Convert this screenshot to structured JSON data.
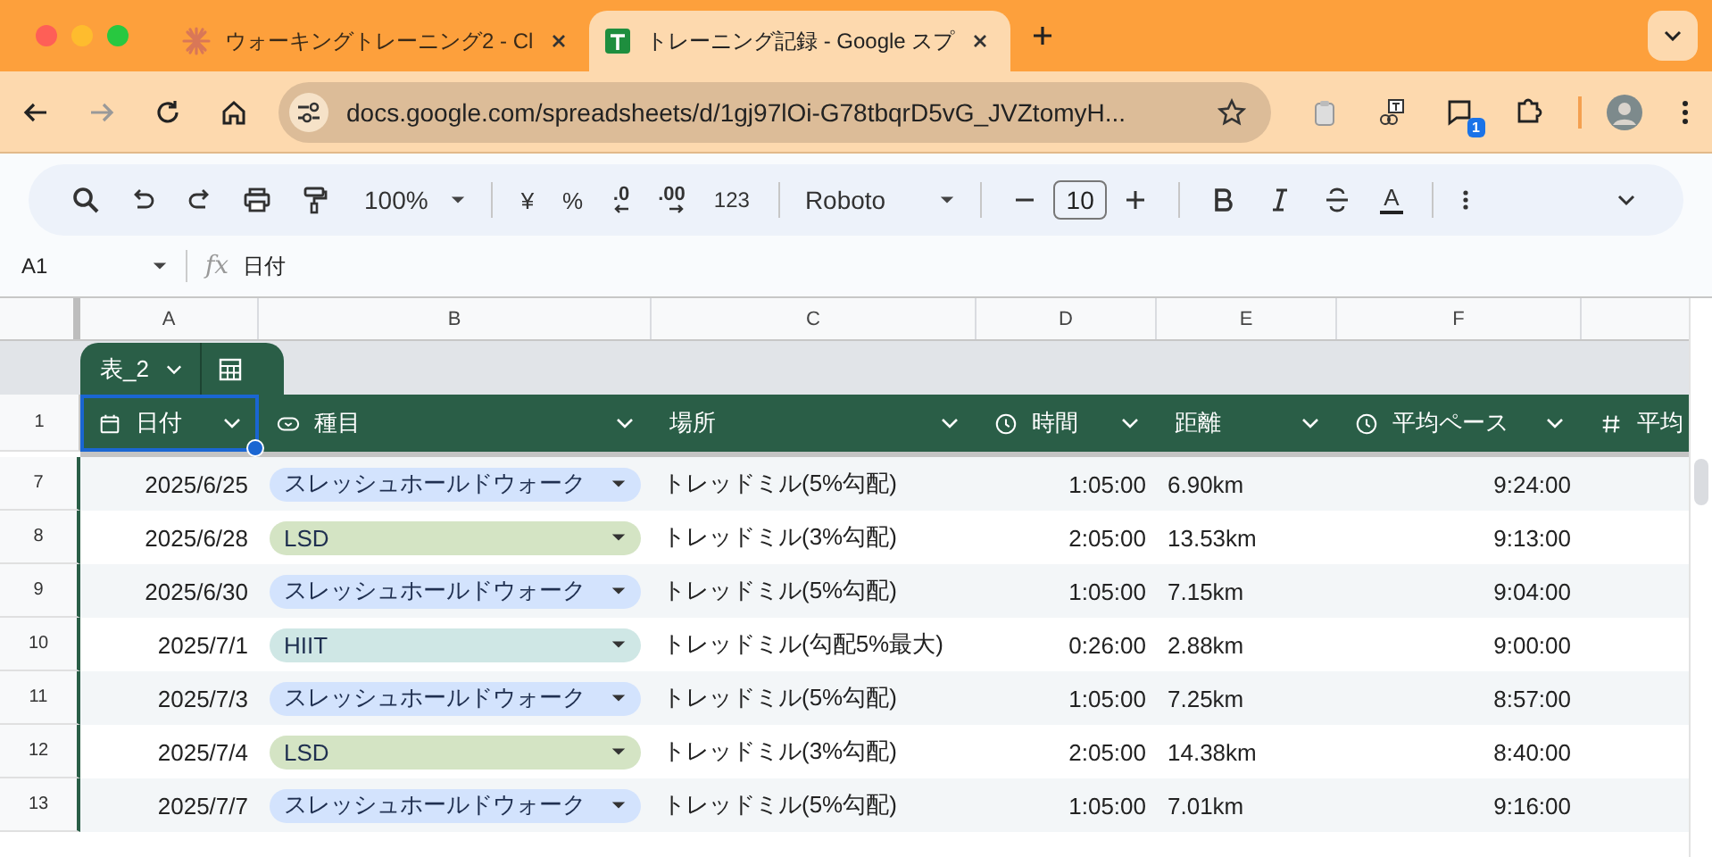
{
  "browser": {
    "tabs": [
      {
        "title": "ウォーキングトレーニング2 - Cl",
        "kind": "claude",
        "selected": false
      },
      {
        "title": "トレーニング記録 - Google スプ",
        "kind": "sheets",
        "selected": true
      }
    ],
    "address": "docs.google.com/spreadsheets/d/1gj97lOi-G78tbqrD5vG_JVZtomyH...",
    "extension_badge": "1"
  },
  "toolbar": {
    "zoom": "100%",
    "currency": "¥",
    "percent": "%",
    "decrease_decimal": ".0",
    "increase_decimal": ".00",
    "number_format": "123",
    "font": "Roboto",
    "font_size": "10",
    "text_color": "A"
  },
  "formula_bar": {
    "cell": "A1",
    "fx": "fx",
    "value": "日付"
  },
  "sheet": {
    "column_letters": [
      "A",
      "B",
      "C",
      "D",
      "E",
      "F"
    ],
    "table_name": "表_2",
    "header_row": "1",
    "columns": [
      {
        "label": "日付",
        "kind": "date",
        "selected": true
      },
      {
        "label": "種目",
        "kind": "chip",
        "selected": false
      },
      {
        "label": "場所",
        "kind": "text",
        "selected": false
      },
      {
        "label": "時間",
        "kind": "time",
        "selected": false
      },
      {
        "label": "距離",
        "kind": "text",
        "selected": false
      },
      {
        "label": "平均ペース",
        "kind": "time",
        "selected": false
      },
      {
        "label": "平均",
        "kind": "number",
        "selected": false
      }
    ],
    "rows": [
      {
        "num": "7",
        "date": "2025/6/25",
        "type": {
          "label": "スレッシュホールドウォーク",
          "color": "#d3e3fd"
        },
        "place": "トレッドミル(5%勾配)",
        "time": "1:05:00",
        "distance": "6.90km",
        "pace": "9:24:00"
      },
      {
        "num": "8",
        "date": "2025/6/28",
        "type": {
          "label": "LSD",
          "color": "#d4e4c4"
        },
        "place": "トレッドミル(3%勾配)",
        "time": "2:05:00",
        "distance": "13.53km",
        "pace": "9:13:00"
      },
      {
        "num": "9",
        "date": "2025/6/30",
        "type": {
          "label": "スレッシュホールドウォーク",
          "color": "#d3e3fd"
        },
        "place": "トレッドミル(5%勾配)",
        "time": "1:05:00",
        "distance": "7.15km",
        "pace": "9:04:00"
      },
      {
        "num": "10",
        "date": "2025/7/1",
        "type": {
          "label": "HIIT",
          "color": "#cfe7e5"
        },
        "place": "トレッドミル(勾配5%最大)",
        "time": "0:26:00",
        "distance": "2.88km",
        "pace": "9:00:00"
      },
      {
        "num": "11",
        "date": "2025/7/3",
        "type": {
          "label": "スレッシュホールドウォーク",
          "color": "#d3e3fd"
        },
        "place": "トレッドミル(5%勾配)",
        "time": "1:05:00",
        "distance": "7.25km",
        "pace": "8:57:00"
      },
      {
        "num": "12",
        "date": "2025/7/4",
        "type": {
          "label": "LSD",
          "color": "#d4e4c4"
        },
        "place": "トレッドミル(3%勾配)",
        "time": "2:05:00",
        "distance": "14.38km",
        "pace": "8:40:00"
      },
      {
        "num": "13",
        "date": "2025/7/7",
        "type": {
          "label": "スレッシュホールドウォーク",
          "color": "#d3e3fd"
        },
        "place": "トレッドミル(5%勾配)",
        "time": "1:05:00",
        "distance": "7.01km",
        "pace": "9:16:00"
      }
    ]
  }
}
